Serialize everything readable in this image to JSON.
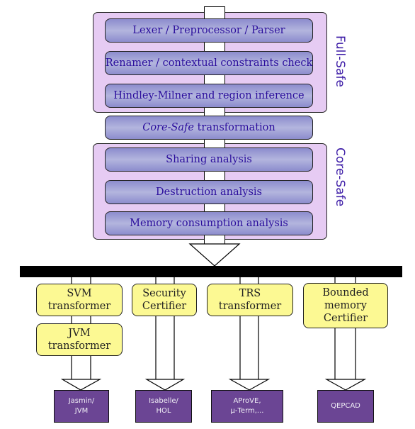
{
  "diagram": {
    "groups": [
      {
        "name": "full-safe",
        "label": "Full-Safe"
      },
      {
        "name": "core-safe",
        "label": "Core-Safe"
      }
    ],
    "stages": [
      {
        "label": "Lexer / Preprocessor / Parser"
      },
      {
        "label": "Renamer / contextual constraints check"
      },
      {
        "label": "Hindley-Milner and region inference"
      },
      {
        "label_italic": "Core-Safe",
        "label_rest": " transformation"
      },
      {
        "label": "Sharing analysis"
      },
      {
        "label": "Destruction analysis"
      },
      {
        "label": "Memory consumption analysis"
      }
    ],
    "backends": [
      {
        "line1": "SVM",
        "line2": "transformer"
      },
      {
        "line1": "JVM",
        "line2": "transformer"
      },
      {
        "line1": "Security",
        "line2": "Certifier"
      },
      {
        "line1": "TRS",
        "line2": "transformer"
      },
      {
        "line1": "Bounded",
        "line2": "memory",
        "line3": "Certifier"
      }
    ],
    "tools": [
      {
        "line1": "Jasmin/",
        "line2": "JVM"
      },
      {
        "line1": "Isabelle/",
        "line2": "HOL"
      },
      {
        "line1": "AProVE,",
        "line2": "μ-Term,..."
      },
      {
        "line1": "QEPCAD"
      }
    ],
    "colors": {
      "group_fill": "#e6cbf3",
      "stage_fill": "#a0a2d6",
      "stage_text": "#2a0d9c",
      "backend_fill": "#fcf993",
      "tool_fill": "#6b4594"
    }
  }
}
